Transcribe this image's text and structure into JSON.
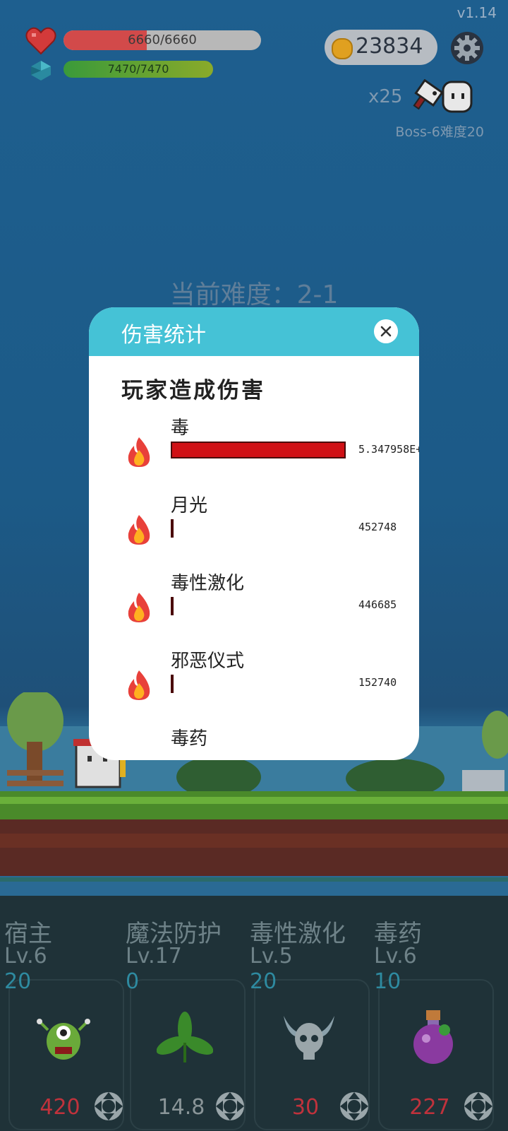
{
  "hud": {
    "hp_text": "6660/6660",
    "hp_fraction": 1.0,
    "mp_text": "7470/7470",
    "mp_fraction": 1.0,
    "version": "v1.14",
    "coins": "23834",
    "multiplier": "x25",
    "boss_label": "Boss-6难度20"
  },
  "difficulty_text": "当前难度：2-1",
  "modal": {
    "title": "伤害统计",
    "subtitle": "玩家造成伤害",
    "rows": [
      {
        "name": "毒",
        "value": "5.347958E+",
        "fraction": 1.0
      },
      {
        "name": "月光",
        "value": "452748",
        "fraction": 0.0085
      },
      {
        "name": "毒性激化",
        "value": "446685",
        "fraction": 0.0084
      },
      {
        "name": "邪恶仪式",
        "value": "152740",
        "fraction": 0.003
      },
      {
        "name": "毒药",
        "value": "",
        "fraction": 0
      }
    ]
  },
  "skills": [
    {
      "name": "宿主",
      "level": "Lv.6",
      "num": "20",
      "cost": "420",
      "cost_color": "#c0323c",
      "icon": "green-monster-icon"
    },
    {
      "name": "魔法防护",
      "level": "Lv.17",
      "num": "0",
      "cost": "14.8",
      "cost_color": "#8a9598",
      "icon": "leaf-icon"
    },
    {
      "name": "毒性激化",
      "level": "Lv.5",
      "num": "20",
      "cost": "30",
      "cost_color": "#c0323c",
      "icon": "horned-skull-icon"
    },
    {
      "name": "毒药",
      "level": "Lv.6",
      "num": "10",
      "cost": "227",
      "cost_color": "#c0323c",
      "icon": "poison-flask-icon"
    }
  ]
}
